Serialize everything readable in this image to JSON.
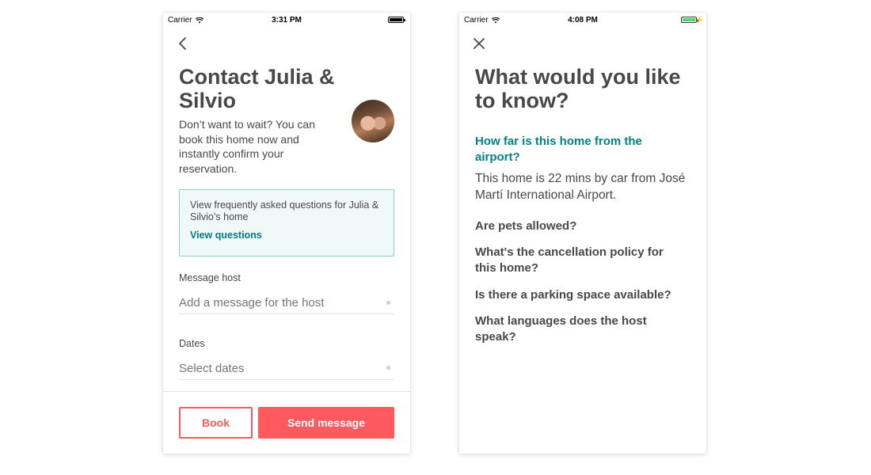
{
  "screen_left": {
    "status": {
      "carrier": "Carrier",
      "time": "3:31 PM"
    },
    "title": "Contact Julia & Silvio",
    "subtitle": "Don’t want to wait? You can book this home now and instantly confirm your reservation.",
    "faq_box": {
      "text": "View frequently asked questions for Julia & Silvio’s home",
      "link_label": "View questions"
    },
    "message_field": {
      "label": "Message host",
      "placeholder": "Add a message for the host"
    },
    "dates_field": {
      "label": "Dates",
      "placeholder": "Select dates"
    },
    "buttons": {
      "book": "Book",
      "send": "Send message"
    }
  },
  "screen_right": {
    "status": {
      "carrier": "Carrier",
      "time": "4:08 PM"
    },
    "title": "What would you like to know?",
    "active_question": "How far is this home from the airport?",
    "answer": "This home is 22 mins by car from José Martí International Airport.",
    "questions": [
      "Are pets allowed?",
      "What's the cancellation policy for this home?",
      "Is there a parking space available?",
      "What languages does the host speak?"
    ]
  },
  "colors": {
    "brand_coral": "#ff5a5f",
    "teal_link": "#007a87",
    "teal_question": "#008489",
    "text_dark": "#484848",
    "faq_bg": "#f1f9f8",
    "faq_border": "#8ecfcb"
  },
  "icons": {
    "left_nav": "chevron-left-icon",
    "right_nav": "close-icon",
    "wifi": "wifi-icon",
    "battery": "battery-icon"
  }
}
